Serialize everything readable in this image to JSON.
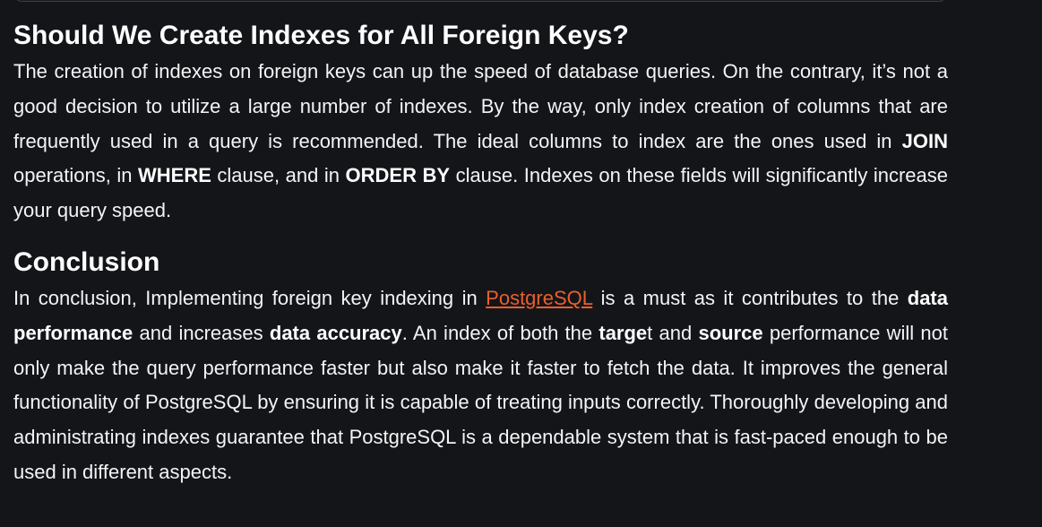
{
  "section1": {
    "heading": "Should We Create Indexes for All Foreign Keys?",
    "p_intro": "The creation of indexes on foreign keys can up the speed of database queries. On the contrary, it’s not a good decision to utilize a large number of indexes. By the way, only index creation of columns that are frequently used in a query is recommended. The ideal columns to index are the ones used in ",
    "kw_join": "JOIN",
    "p_mid1": " operations, in ",
    "kw_where": "WHERE",
    "p_mid2": " clause, and in ",
    "kw_orderby": "ORDER BY",
    "p_end": " clause. Indexes on these fields will significantly increase your query speed."
  },
  "section2": {
    "heading": "Conclusion",
    "p_start": "In conclusion, Implementing foreign key indexing in ",
    "link_postgresql": "PostgreSQL",
    "p_mid1": " is a must as it contributes to the ",
    "b_data_performance": "data performance",
    "p_mid2": " and increases ",
    "b_data_accuracy": "data accuracy",
    "p_mid3": ". An index of both the ",
    "b_targe": "targe",
    "p_t": "t and ",
    "b_source": "source",
    "p_end": " performance will not only make the query performance faster but also make it faster to fetch the data. It improves the general functionality of PostgreSQL by ensuring it is capable of treating inputs correctly. Thoroughly developing and administrating indexes guarantee that PostgreSQL is a dependable system that is fast-paced enough to be used in different aspects."
  },
  "colors": {
    "background": "#141519",
    "text": "#ffffff",
    "link": "#e8602c"
  }
}
